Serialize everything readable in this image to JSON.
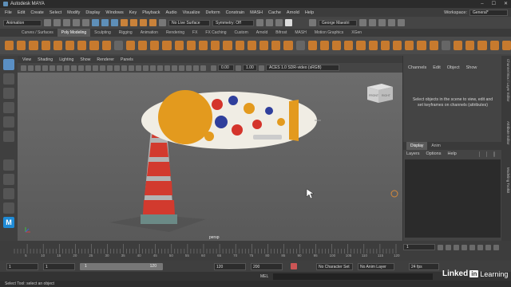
{
  "window": {
    "title": "Autodesk MAYA",
    "controls": [
      "–",
      "☐",
      "✕"
    ]
  },
  "menubar": [
    "File",
    "Edit",
    "Create",
    "Select",
    "Modify",
    "Display",
    "Windows",
    "Key",
    "Playback",
    "Audio",
    "Visualize",
    "Deform",
    "Constrain",
    "MASH",
    "Cache",
    "Arnold",
    "Help"
  ],
  "workspace": {
    "label": "Workspace:",
    "value": "General*"
  },
  "statusline": {
    "mode": "Animation",
    "live_surface": "No Live Surface",
    "symmetry": "Symmetry: Off",
    "user": "George Maestri"
  },
  "shelf_tabs": [
    "Curves / Surfaces",
    "Poly Modeling",
    "Sculpting",
    "Rigging",
    "Animation",
    "Rendering",
    "FX",
    "FX Caching",
    "Custom",
    "Arnold",
    "Bifrost",
    "MASH",
    "Motion Graphics",
    "XGen"
  ],
  "active_shelf_tab": "Poly Modeling",
  "panel_menu": [
    "View",
    "Shading",
    "Lighting",
    "Show",
    "Renderer",
    "Panels"
  ],
  "viewport_toolbar": {
    "exposure": "0.00",
    "gamma": "1.00",
    "color_space": "ACES 1.0 SDR-video (sRGB)"
  },
  "viewport": {
    "camera": "persp",
    "viewcube_front": "FRONT",
    "viewcube_right": "RIGHT"
  },
  "channel_box": {
    "menu": [
      "Channels",
      "Edit",
      "Object",
      "Show"
    ],
    "message": "Select objects in the scene to view, edit and set keyframes on channels (attributes)"
  },
  "layer_editor": {
    "tabs": [
      "Display",
      "Anim"
    ],
    "menu": [
      "Layers",
      "Options",
      "Help"
    ]
  },
  "side_tabs": [
    "Channel Box / Layer Editor",
    "Attribute Editor",
    "Modeling Toolkit"
  ],
  "time_slider": {
    "ticks": [
      "5",
      "10",
      "15",
      "20",
      "25",
      "30",
      "35",
      "40",
      "45",
      "50",
      "55",
      "60",
      "65",
      "70",
      "75",
      "80",
      "85",
      "90",
      "95",
      "100",
      "105",
      "110",
      "115",
      "120"
    ],
    "current_frame": "1"
  },
  "range_slider": {
    "start": "1",
    "inner_start": "1",
    "inner_start2": "1",
    "inner_end": "120",
    "end": "120",
    "max": "200",
    "character_set": "No Character Set",
    "anim_layer": "No Anim Layer",
    "fps": "24 fps"
  },
  "command_line": {
    "label": "MEL"
  },
  "help_line": {
    "text": "Select Tool: select an object"
  },
  "watermark": {
    "brand": "Linked",
    "in": "in",
    "suffix": "Learning"
  },
  "colors": {
    "accent": "#5a8fc4",
    "shelf_icon": "#c77a2e",
    "viewport_top": "#6c6c6c",
    "blimp_orange": "#e39a1e",
    "tower_red": "#d23a2e"
  }
}
